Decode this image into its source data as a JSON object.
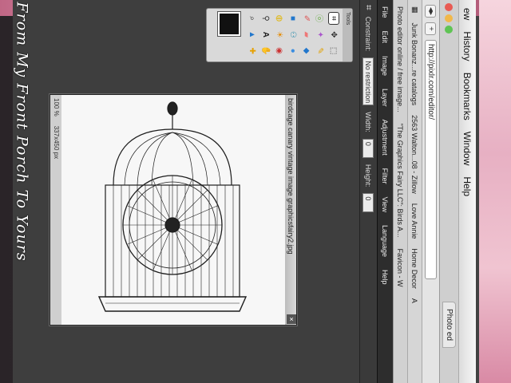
{
  "browser": {
    "menus": [
      "History",
      "Bookmarks",
      "Window",
      "Help"
    ],
    "menu_cut": "ew",
    "tabs": [
      "Photo ed"
    ],
    "url": "http://pixlr.com/editor/",
    "bookmarks_row1": [
      "Junk Bonanz...re catalogs",
      "2563 Walton...08 - Zillow",
      "Love Annie",
      "Home Decor",
      "A"
    ],
    "bookmarks_row2": [
      "Photo editor online / free image...",
      "\"The Graphics Fairy LLC\": Birds A...",
      "Favicon - W"
    ]
  },
  "editor": {
    "menu": [
      "File",
      "Edit",
      "Image",
      "Layer",
      "Adjustment",
      "Filter",
      "View",
      "Language",
      "Help"
    ],
    "options": {
      "constraint_label": "Constraint:",
      "constraint_value": "No restriction",
      "width_label": "Width:",
      "width_value": "0",
      "height_label": "Height:",
      "height_value": "0"
    },
    "tools_title": "Tools",
    "document": {
      "title": "birdcage canary vintage image graphicsfairy2.jpg",
      "zoom": "100",
      "zoom_unit": "%",
      "size": "337x450 px"
    }
  },
  "overlay_caption": "From My Front Porch To Yours",
  "colors": {
    "accent_pink": "#e5a3b9",
    "workspace": "#3e3e3e",
    "swatch": "#111111"
  }
}
